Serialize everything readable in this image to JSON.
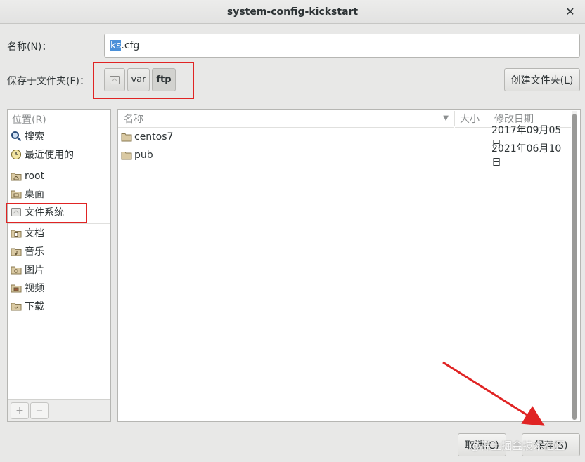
{
  "window": {
    "title": "system-config-kickstart"
  },
  "name_label": "名称(N)：",
  "name_input": {
    "selected": "ks",
    "rest": ".cfg"
  },
  "save_in_label": "保存于文件夹(F)：",
  "path_bar": {
    "segments": [
      "var",
      "ftp"
    ]
  },
  "create_folder_label": "创建文件夹(L)",
  "places": {
    "header": "位置(R)",
    "items": [
      {
        "label": "搜索",
        "icon": "search-icon"
      },
      {
        "label": "最近使用的",
        "icon": "recent-icon"
      },
      {
        "label": "root",
        "icon": "home-folder-icon"
      },
      {
        "label": "桌面",
        "icon": "desktop-folder-icon"
      },
      {
        "label": "文件系统",
        "icon": "drive-icon"
      },
      {
        "label": "文档",
        "icon": "documents-folder-icon"
      },
      {
        "label": "音乐",
        "icon": "music-folder-icon"
      },
      {
        "label": "图片",
        "icon": "pictures-folder-icon"
      },
      {
        "label": "视频",
        "icon": "videos-folder-icon"
      },
      {
        "label": "下载",
        "icon": "downloads-folder-icon"
      }
    ],
    "add_label": "+",
    "remove_label": "—"
  },
  "file_list": {
    "columns": {
      "name": "名称",
      "size": "大小",
      "modified": "修改日期"
    },
    "rows": [
      {
        "name": "centos7",
        "size": "",
        "modified": "2017年09月05日"
      },
      {
        "name": "pub",
        "size": "",
        "modified": "2021年06月10日"
      }
    ]
  },
  "buttons": {
    "cancel": "取消(C)",
    "save": "保存(S)"
  },
  "watermark": "@稀土掘金技术社区",
  "colors": {
    "annotation_red": "#e02424",
    "selection_blue": "#4a90d9"
  }
}
